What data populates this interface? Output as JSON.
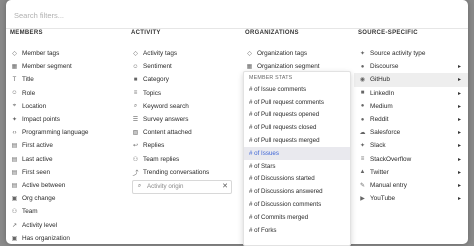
{
  "search": {
    "placeholder": "Search filters..."
  },
  "columns": {
    "members": {
      "header": "MEMBERS",
      "items": [
        {
          "label": "Member tags",
          "icon": "tag-icon"
        },
        {
          "label": "Member segment",
          "icon": "segment-icon"
        },
        {
          "label": "Title",
          "icon": "title-icon"
        },
        {
          "label": "Role",
          "icon": "person-icon"
        },
        {
          "label": "Location",
          "icon": "location-icon"
        },
        {
          "label": "Impact points",
          "icon": "impact-icon"
        },
        {
          "label": "Programming language",
          "icon": "code-icon"
        },
        {
          "label": "First active",
          "icon": "calendar-icon"
        },
        {
          "label": "Last active",
          "icon": "calendar-icon"
        },
        {
          "label": "First seen",
          "icon": "calendar-icon"
        },
        {
          "label": "Active between",
          "icon": "calendar-range-icon"
        },
        {
          "label": "Org change",
          "icon": "org-icon"
        },
        {
          "label": "Team",
          "icon": "team-icon"
        },
        {
          "label": "Activity level",
          "icon": "activity-icon"
        },
        {
          "label": "Has organization",
          "icon": "org-icon"
        }
      ]
    },
    "activity": {
      "header": "ACTIVITY",
      "items": [
        {
          "label": "Activity tags",
          "icon": "tag-icon"
        },
        {
          "label": "Sentiment",
          "icon": "sentiment-icon"
        },
        {
          "label": "Category",
          "icon": "category-icon"
        },
        {
          "label": "Topics",
          "icon": "topics-icon"
        },
        {
          "label": "Keyword search",
          "icon": "search-icon"
        },
        {
          "label": "Survey answers",
          "icon": "survey-icon"
        },
        {
          "label": "Content attached",
          "icon": "attachment-icon"
        },
        {
          "label": "Replies",
          "icon": "reply-icon"
        },
        {
          "label": "Team replies",
          "icon": "team-icon"
        },
        {
          "label": "Trending conversations",
          "icon": "trending-icon"
        }
      ],
      "origin": {
        "label": "Activity origin",
        "icon": "search-icon",
        "clear_icon": "close-icon"
      }
    },
    "organizations": {
      "header": "ORGANIZATIONS",
      "items": [
        {
          "label": "Organization tags",
          "icon": "tag-icon"
        },
        {
          "label": "Organization segment",
          "icon": "segment-icon"
        }
      ]
    },
    "source": {
      "header": "SOURCE-SPECIFIC",
      "items": [
        {
          "label": "Source activity type",
          "icon": "source-icon"
        },
        {
          "label": "Discourse",
          "icon": "discourse-icon"
        },
        {
          "label": "GitHub",
          "icon": "github-icon"
        },
        {
          "label": "LinkedIn",
          "icon": "linkedin-icon"
        },
        {
          "label": "Medium",
          "icon": "medium-icon"
        },
        {
          "label": "Reddit",
          "icon": "reddit-icon"
        },
        {
          "label": "Salesforce",
          "icon": "salesforce-icon"
        },
        {
          "label": "Slack",
          "icon": "slack-icon"
        },
        {
          "label": "StackOverflow",
          "icon": "stackoverflow-icon"
        },
        {
          "label": "Twitter",
          "icon": "twitter-icon"
        },
        {
          "label": "Manual entry",
          "icon": "manual-entry-icon"
        },
        {
          "label": "YouTube",
          "icon": "youtube-icon"
        }
      ]
    }
  },
  "member_stats": {
    "header": "MEMBER STATS",
    "items": [
      "# of Issue comments",
      "# of Pull request comments",
      "# of Pull requests opened",
      "# of Pull requests closed",
      "# of Pull requests merged",
      "# of Issues",
      "# of Stars",
      "# of Discussions started",
      "# of Discussions answered",
      "# of Discussion comments",
      "# of Commits merged",
      "# of Forks"
    ],
    "selected": "# of Issues"
  },
  "colors": {
    "accent": "#3b63d6",
    "highlight": "#eeeeee"
  }
}
